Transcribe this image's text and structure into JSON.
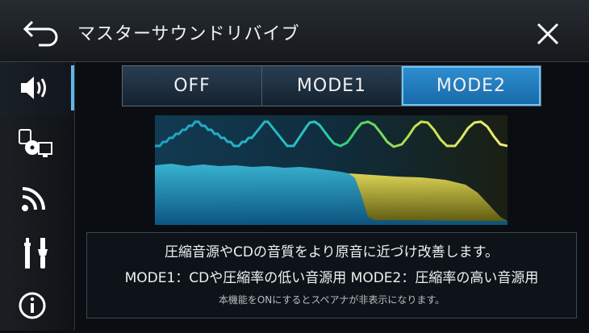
{
  "header": {
    "title": "マスターサウンドリバイブ"
  },
  "sidebar": {
    "items": [
      {
        "icon": "speaker-icon",
        "active": true
      },
      {
        "icon": "media-source-icon",
        "active": false
      },
      {
        "icon": "wireless-signal-icon",
        "active": false
      },
      {
        "icon": "tools-icon",
        "active": false
      },
      {
        "icon": "info-icon",
        "active": false
      }
    ]
  },
  "mode_selector": {
    "options": [
      "OFF",
      "MODE1",
      "MODE2"
    ],
    "selected": "MODE2"
  },
  "info": {
    "line1": "圧縮音源やCDの音質をより原音に近づけ改善します。",
    "line2": "MODE1：CDや圧縮率の低い音源用 MODE2：圧縮率の高い音源用",
    "note": "本機能をONにするとスペアナが非表示になります。"
  },
  "colors": {
    "accent": "#5fb6ea",
    "selected_button": "#1f7cc0",
    "spectrum_cyan": "#2fb6d8",
    "spectrum_yellow": "#e8e04a"
  }
}
